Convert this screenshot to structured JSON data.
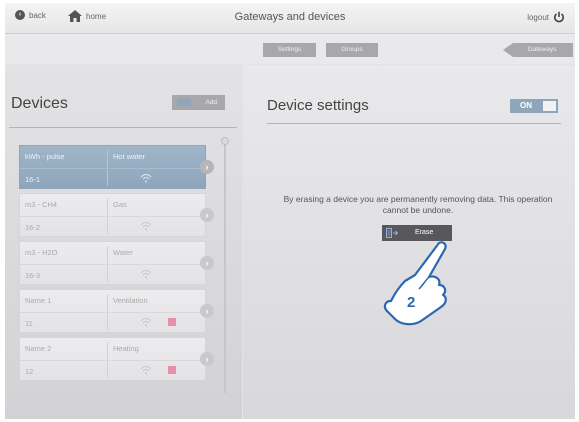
{
  "topbar": {
    "back_label": "back",
    "home_label": "home",
    "title": "Gateways and devices",
    "logout_label": "logout"
  },
  "subbar": {
    "settings_label": "Settings",
    "groups_label": "Groups",
    "gateways_label": "Gateways"
  },
  "devices_panel": {
    "title": "Devices",
    "add_label": "Add",
    "items": [
      {
        "unit": "kWh - pulse",
        "name": "Hot water",
        "id": "16-1",
        "selected": true,
        "warning": false
      },
      {
        "unit": "m3 - CH4",
        "name": "Gas",
        "id": "16-2",
        "selected": false,
        "warning": false
      },
      {
        "unit": "m3 - H2O",
        "name": "Water",
        "id": "16-3",
        "selected": false,
        "warning": false
      },
      {
        "unit": "Name 1",
        "name": "Ventilation",
        "id": "11",
        "selected": false,
        "warning": true
      },
      {
        "unit": "Name 2",
        "name": "Heating",
        "id": "12",
        "selected": false,
        "warning": true
      }
    ]
  },
  "settings_panel": {
    "title": "Device settings",
    "toggle_label": "ON",
    "erase_message": "By erasing a device you are permanently removing data. This operation cannot be undone.",
    "erase_label": "Erase",
    "callout_number": "2"
  },
  "colors": {
    "accent": "#8ea6bc",
    "button_gray": "#a8a8aa",
    "erase_bg": "#58585b",
    "warning": "#e590a6"
  }
}
